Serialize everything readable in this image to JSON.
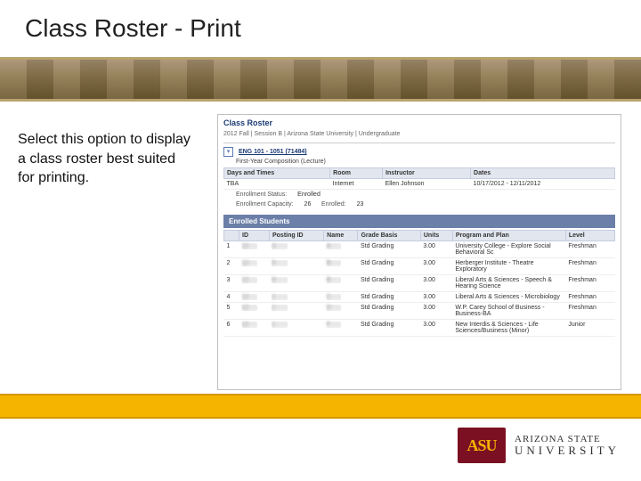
{
  "slide": {
    "title": "Class Roster - Print",
    "description": "Select this option to display a class roster best suited for printing."
  },
  "roster": {
    "heading": "Class Roster",
    "breadcrumb": "2012 Fall | Session B | Arizona State University | Undergraduate",
    "course_link": "ENG 101 - 1051 (71484)",
    "course_sub": "First-Year Composition (Lecture)",
    "meeting": {
      "headers": [
        "Days and Times",
        "Room",
        "Instructor",
        "Dates"
      ],
      "row": [
        "TBA",
        "Internet",
        "Ellen Johnson",
        "10/17/2012 - 12/11/2012"
      ]
    },
    "status_label": "Enrollment Status:",
    "status_value": "Enrolled",
    "cap_label": "Enrollment Capacity:",
    "cap_value": "26",
    "enr_label": "Enrolled:",
    "enr_value": "23",
    "table_title": "Enrolled Students",
    "cols": [
      "",
      "ID",
      "Posting ID",
      "Name",
      "Grade Basis",
      "Units",
      "Program and Plan",
      "Level"
    ],
    "rows": [
      {
        "n": "1",
        "id": "12····",
        "pid": "3······",
        "name": "A·····",
        "gb": "Std Grading",
        "units": "3.00",
        "pp": "University College - Explore Social Behavioral Sc",
        "lvl": "Freshman"
      },
      {
        "n": "2",
        "id": "12····",
        "pid": "5······",
        "name": "B·····",
        "gb": "Std Grading",
        "units": "3.00",
        "pp": "Herberger Institute - Theatre Exploratory",
        "lvl": "Freshman"
      },
      {
        "n": "3",
        "id": "12····",
        "pid": "9······",
        "name": "B·····",
        "gb": "Std Grading",
        "units": "3.00",
        "pp": "Liberal Arts & Sciences - Speech & Hearing Science",
        "lvl": "Freshman"
      },
      {
        "n": "4",
        "id": "12····",
        "pid": "1······",
        "name": "C·····",
        "gb": "Std Grading",
        "units": "3.00",
        "pp": "Liberal Arts & Sciences - Microbiology",
        "lvl": "Freshman"
      },
      {
        "n": "5",
        "id": "12····",
        "pid": "1······",
        "name": "D·····",
        "gb": "Std Grading",
        "units": "3.00",
        "pp": "W.P. Carey School of Business - Business-BA",
        "lvl": "Freshman"
      },
      {
        "n": "6",
        "id": "12····",
        "pid": "1······",
        "name": "F·····",
        "gb": "Std Grading",
        "units": "3.00",
        "pp": "New Interdis & Sciences - Life Sciences/Business (Minor)",
        "lvl": "Junior"
      }
    ]
  },
  "logo": {
    "mark": "ASU",
    "line1": "ARIZONA STATE",
    "line2": "UNIVERSITY"
  }
}
